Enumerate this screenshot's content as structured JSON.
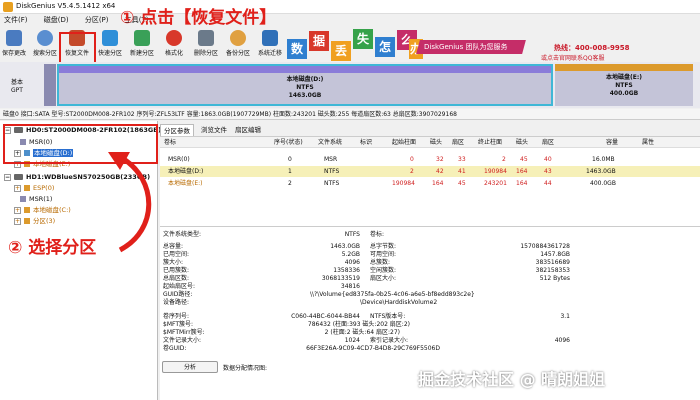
{
  "app": {
    "title": "DiskGenius V5.4.5.1412 x64"
  },
  "menu": [
    "文件(F)",
    "磁盘(D)",
    "分区(P)",
    "工具(T)"
  ],
  "toolbar": [
    {
      "label": "保存更改",
      "icon": "save-icon",
      "color": "#4a7bc0"
    },
    {
      "label": "搜索分区",
      "icon": "search-icon",
      "color": "#5a8ed0"
    },
    {
      "label": "恢复文件",
      "icon": "recover-files-icon",
      "color": "#c44a2a"
    },
    {
      "label": "快速分区",
      "icon": "quick-partition-icon",
      "color": "#2f8fd8"
    },
    {
      "label": "新建分区",
      "icon": "new-partition-icon",
      "color": "#3aa058"
    },
    {
      "label": "格式化",
      "icon": "format-icon",
      "color": "#d8382a"
    },
    {
      "label": "删除分区",
      "icon": "delete-partition-icon",
      "color": "#6b7a8a"
    },
    {
      "label": "备份分区",
      "icon": "backup-partition-icon",
      "color": "#e0a040"
    },
    {
      "label": "系统迁移",
      "icon": "system-migrate-icon",
      "color": "#3070b8"
    }
  ],
  "annotations": {
    "step1": "① 点击【恢复文件】",
    "step2": "② 选择分区"
  },
  "banner": {
    "chars": [
      "数",
      "据",
      "丢",
      "失",
      "怎",
      "么",
      "办"
    ],
    "char_colors": [
      "#2f7fd0",
      "#d8382a",
      "#f0a020",
      "#36a24a",
      "#2f7fd0",
      "#c52d68",
      "#f0a020"
    ],
    "brand": "DiskGenius 团队为您服务",
    "hotline": "热线：400-008-9958",
    "hotline_sub": "或点击官网联系QQ客服"
  },
  "disk_bar": {
    "side_label_1": "基本",
    "side_label_2": "GPT",
    "partition_d": {
      "name": "本地磁盘(D:)",
      "fs": "NTFS",
      "size": "1463.0GB"
    },
    "partition_e": {
      "name": "本地磁盘(E:)",
      "fs": "NTFS",
      "size": "400.0GB"
    }
  },
  "disk_info": "磁盘0 接口:SATA  型号:ST2000DM008-2FR102  序列号:ZFL53LTF  容量:1863.0GB(1907729MB)  柱面数:243201  磁头数:255  每道扇区数:63  总扇区数:3907029168",
  "tree": {
    "disk0": "HD0:ST2000DM008-2FR102(1863GB)",
    "disk0_parts": [
      "MSR(0)",
      "本地磁盘(D:)",
      "本地磁盘(E:)"
    ],
    "disk1": "HD1:WDBlueSN570250GB(233GB)",
    "disk1_parts": [
      "ESP(0)",
      "MSR(1)",
      "本地磁盘(C:)",
      "分区(3)"
    ]
  },
  "tabs": [
    "分区参数",
    "浏览文件",
    "扇区编辑"
  ],
  "partition_table": {
    "headers": [
      "卷标",
      "序号(状态)",
      "文件系统",
      "标识",
      "起始柱面",
      "磁头",
      "扇区",
      "终止柱面",
      "磁头",
      "扇区",
      "容量",
      "属性"
    ],
    "rows": [
      [
        "MSR(0)",
        "0",
        "MSR",
        "",
        "0",
        "32",
        "33",
        "2",
        "45",
        "40",
        "16.0MB",
        ""
      ],
      [
        "本地磁盘(D:)",
        "1",
        "NTFS",
        "",
        "2",
        "42",
        "41",
        "190984",
        "164",
        "43",
        "1463.0GB",
        ""
      ],
      [
        "本地磁盘(E:)",
        "2",
        "NTFS",
        "",
        "190984",
        "164",
        "45",
        "243201",
        "164",
        "44",
        "400.0GB",
        ""
      ]
    ]
  },
  "details": {
    "fs_type_label": "文件系统类型:",
    "fs_type": "NTFS",
    "volume_label_label": "卷标:",
    "left": [
      [
        "总容量:",
        "1463.0GB"
      ],
      [
        "已用空间:",
        "5.2GB"
      ],
      [
        "簇大小:",
        "4096"
      ],
      [
        "已用簇数:",
        "1358336"
      ],
      [
        "总扇区数:",
        "3068133519"
      ],
      [
        "起始扇区号:",
        "34816"
      ]
    ],
    "right": [
      [
        "总字节数:",
        "1570884361728"
      ],
      [
        "可用空间:",
        "1457.8GB"
      ],
      [
        "总簇数:",
        "383516689"
      ],
      [
        "空闲簇数:",
        "382158353"
      ],
      [
        "扇区大小:",
        "512 Bytes"
      ],
      [
        "",
        ""
      ]
    ],
    "guid_path_label": "GUID路径:",
    "guid_path": "\\\\?\\Volume{ed8375fa-0b25-4c06-a6e5-bf8edd893c2e}",
    "device_path_label": "设备路径:",
    "device_path": "\\Device\\HarddiskVolume2",
    "left2": [
      [
        "卷序列号:",
        "C060-44BC-6044-BB44"
      ],
      [
        "$MFT簇号:",
        "786432 (柱面:393 磁头:202 扇区:2)"
      ],
      [
        "$MFTMirr簇号:",
        "2 (柱面:2 磁头:64 扇区:27)"
      ],
      [
        "文件记录大小:",
        "1024"
      ],
      [
        "卷GUID:",
        "66F3E26A-9C09-4CD7-B4D8-29C769F5506D"
      ]
    ],
    "right2": [
      [
        "NTFS版本号:",
        "3.1"
      ],
      [
        "",
        ""
      ],
      [
        "",
        ""
      ],
      [
        "索引记录大小:",
        "4096"
      ],
      [
        "",
        ""
      ]
    ],
    "analyze_button": "分析",
    "analyze_label": "数据分配情况图:"
  },
  "watermark": "掘金技术社区 @ 晴朗姐姐"
}
